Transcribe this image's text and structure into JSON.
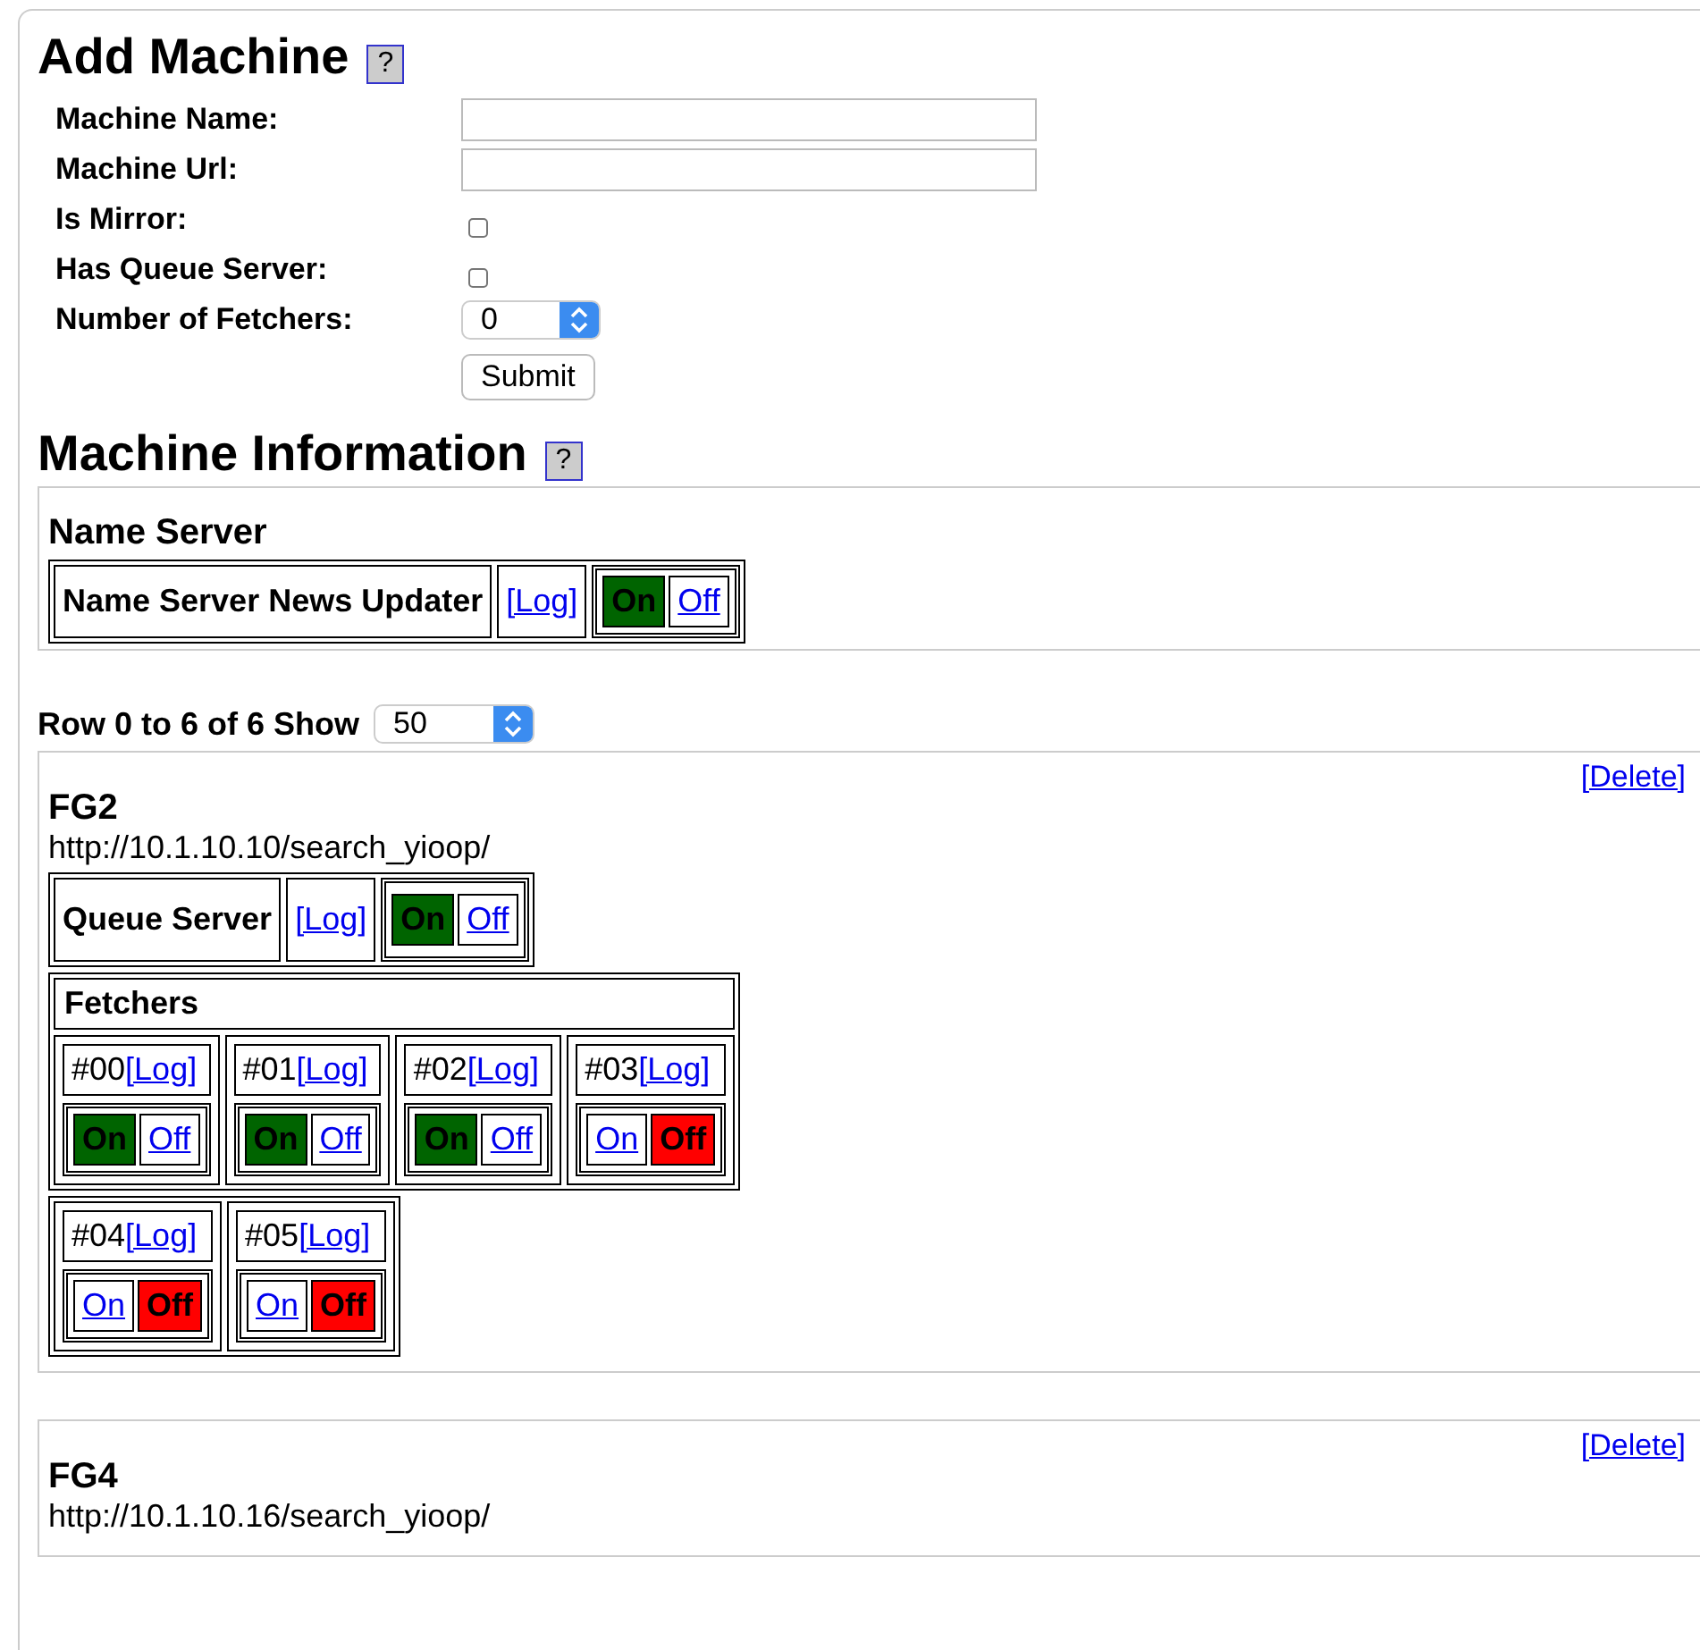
{
  "add_machine": {
    "title": "Add Machine",
    "help": "?",
    "fields": [
      {
        "kind": "text",
        "label": "Machine Name:"
      },
      {
        "kind": "text",
        "label": "Machine Url:"
      },
      {
        "kind": "checkbox",
        "label": "Is Mirror:",
        "checked": false
      },
      {
        "kind": "checkbox",
        "label": "Has Queue Server:",
        "checked": false
      },
      {
        "kind": "select",
        "label": "Number of Fetchers:",
        "value": "0"
      }
    ],
    "submit": "Submit"
  },
  "machine_information": {
    "title": "Machine Information",
    "help": "?",
    "name_server": {
      "title": "Name Server",
      "service": "Name Server News Updater",
      "log": "[Log]",
      "on_label": "On",
      "off_label": "Off",
      "on": true
    },
    "pager": {
      "label": "Row 0 to 6 of 6 Show",
      "value": "50"
    },
    "machines": [
      {
        "delete": "[Delete]",
        "name": "FG2",
        "url": "http://10.1.10.10/search_yioop/",
        "queue_server": {
          "label": "Queue Server",
          "log": "[Log]",
          "on_label": "On",
          "off_label": "Off",
          "on": true
        },
        "fetchers_title": "Fetchers",
        "fetchers": [
          {
            "id": "#00",
            "log": "[Log]",
            "on_label": "On",
            "off_label": "Off",
            "on": true
          },
          {
            "id": "#01",
            "log": "[Log]",
            "on_label": "On",
            "off_label": "Off",
            "on": true
          },
          {
            "id": "#02",
            "log": "[Log]",
            "on_label": "On",
            "off_label": "Off",
            "on": true
          },
          {
            "id": "#03",
            "log": "[Log]",
            "on_label": "On",
            "off_label": "Off",
            "on": false
          },
          {
            "id": "#04",
            "log": "[Log]",
            "on_label": "On",
            "off_label": "Off",
            "on": false
          },
          {
            "id": "#05",
            "log": "[Log]",
            "on_label": "On",
            "off_label": "Off",
            "on": false
          }
        ]
      },
      {
        "delete": "[Delete]",
        "name": "FG4",
        "url": "http://10.1.10.16/search_yioop/"
      }
    ]
  }
}
